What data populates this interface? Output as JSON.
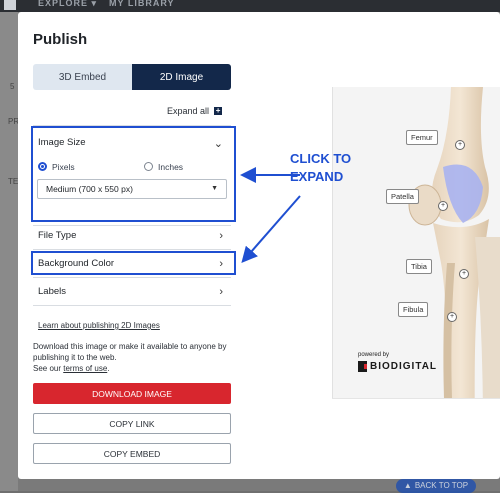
{
  "topbar": {
    "nav": [
      "EXPLORE",
      "MY LIBRARY"
    ],
    "explore_caret": "▾"
  },
  "background": {
    "left_fragments": [
      "5",
      "PR",
      "TE"
    ],
    "back_to_top": "BACK TO TOP"
  },
  "modal": {
    "title": "Publish",
    "tabs": [
      {
        "label": "3D Embed",
        "active": false
      },
      {
        "label": "2D Image",
        "active": true
      }
    ],
    "expand_all": "Expand all",
    "image_size": {
      "label": "Image Size",
      "options": [
        {
          "label": "Pixels",
          "selected": true
        },
        {
          "label": "Inches",
          "selected": false
        }
      ],
      "select_value": "Medium (700 x 550 px)"
    },
    "sections": [
      "File Type",
      "Background Color",
      "Labels"
    ],
    "learn_link": "Learn about publishing 2D Images",
    "description_1": "Download this image or make it available to anyone by publishing it to the web.",
    "description_2_prefix": "See our ",
    "terms_link": "terms of use",
    "description_2_suffix": ".",
    "buttons": {
      "download": "DOWNLOAD IMAGE",
      "copy_link": "COPY LINK",
      "copy_embed": "COPY EMBED"
    }
  },
  "annotation": {
    "callout_line1": "CLICK TO",
    "callout_line2": "EXPAND"
  },
  "preview": {
    "labels": [
      "Femur",
      "Patella",
      "Tibia",
      "Fibula"
    ],
    "powered_by": "powered by",
    "brand": "BIODIGITAL"
  },
  "colors": {
    "accent": "#1f4fd1",
    "navy": "#13284a",
    "danger": "#d8262e"
  }
}
